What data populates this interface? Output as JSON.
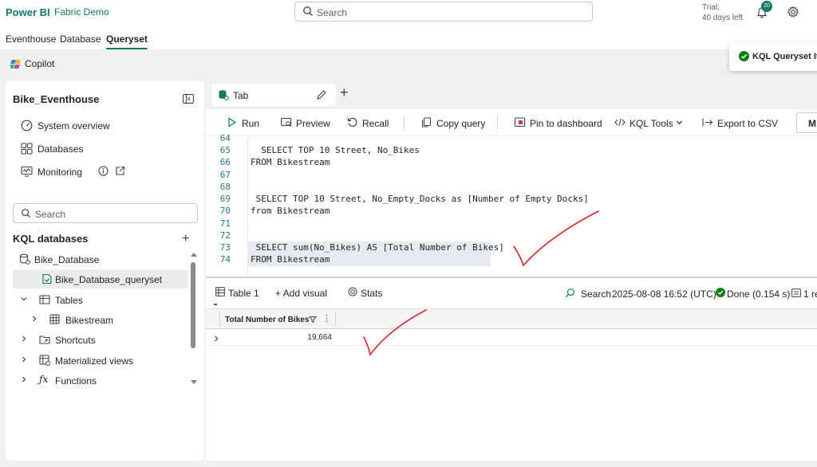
{
  "header": {
    "brand": "Power BI",
    "workspace": "Fabric Demo",
    "search_placeholder": "Search",
    "trial_line1": "Trial:",
    "trial_line2": "40 days left",
    "notification_count": "20"
  },
  "item_tabs": [
    {
      "label": "Eventhouse",
      "active": false
    },
    {
      "label": "Database",
      "active": false
    },
    {
      "label": "Queryset",
      "active": true
    }
  ],
  "copilot": {
    "label": "Copilot"
  },
  "toast": {
    "text": "KQL Queryset Ite",
    "status_color": "#107c10"
  },
  "left_panel": {
    "title": "Bike_Eventhouse",
    "nav": [
      {
        "label": "System overview",
        "icon": "gauge-icon"
      },
      {
        "label": "Databases",
        "icon": "grid-icon"
      },
      {
        "label": "Monitoring",
        "icon": "monitor-icon"
      }
    ],
    "search_placeholder": "Search",
    "kql_heading": "KQL databases",
    "tree": {
      "database": "Bike_Database",
      "queryset": "Bike_Database_queryset",
      "tables": "Tables",
      "bikestream": "Bikestream",
      "shortcuts": "Shortcuts",
      "materialized_views": "Materialized views",
      "functions": "Functions"
    }
  },
  "query_tab": {
    "label": "Tab"
  },
  "toolbar": {
    "run": "Run",
    "preview": "Preview",
    "recall": "Recall",
    "copy_query": "Copy query",
    "pin": "Pin to dashboard",
    "kql_tools": "KQL Tools",
    "export": "Export to CSV",
    "more": "M"
  },
  "editor": {
    "lines": [
      {
        "n": "64",
        "code": ""
      },
      {
        "n": "65",
        "code": "  SELECT TOP 10 Street, No_Bikes"
      },
      {
        "n": "66",
        "code": "FROM Bikestream"
      },
      {
        "n": "67",
        "code": ""
      },
      {
        "n": "68",
        "code": ""
      },
      {
        "n": "69",
        "code": " SELECT TOP 10 Street, No_Empty_Docks as [Number of Empty Docks]"
      },
      {
        "n": "70",
        "code": "from Bikestream"
      },
      {
        "n": "71",
        "code": ""
      },
      {
        "n": "72",
        "code": ""
      },
      {
        "n": "73",
        "code": " SELECT sum(No_Bikes) AS [Total Number of Bikes]"
      },
      {
        "n": "74",
        "code": "FROM Bikestream"
      }
    ]
  },
  "results": {
    "tab_table": "Table 1",
    "tab_add_visual": "+ Add visual",
    "tab_stats": "Stats",
    "search": "Search",
    "timestamp": "2025-08-08 16:52 (UTC)",
    "status": "Done (0.154 s)",
    "rows": "1 re",
    "column": "Total Number of Bikes",
    "value": "19,664"
  },
  "colors": {
    "accent": "#117865",
    "annotation": "#e0262a"
  }
}
